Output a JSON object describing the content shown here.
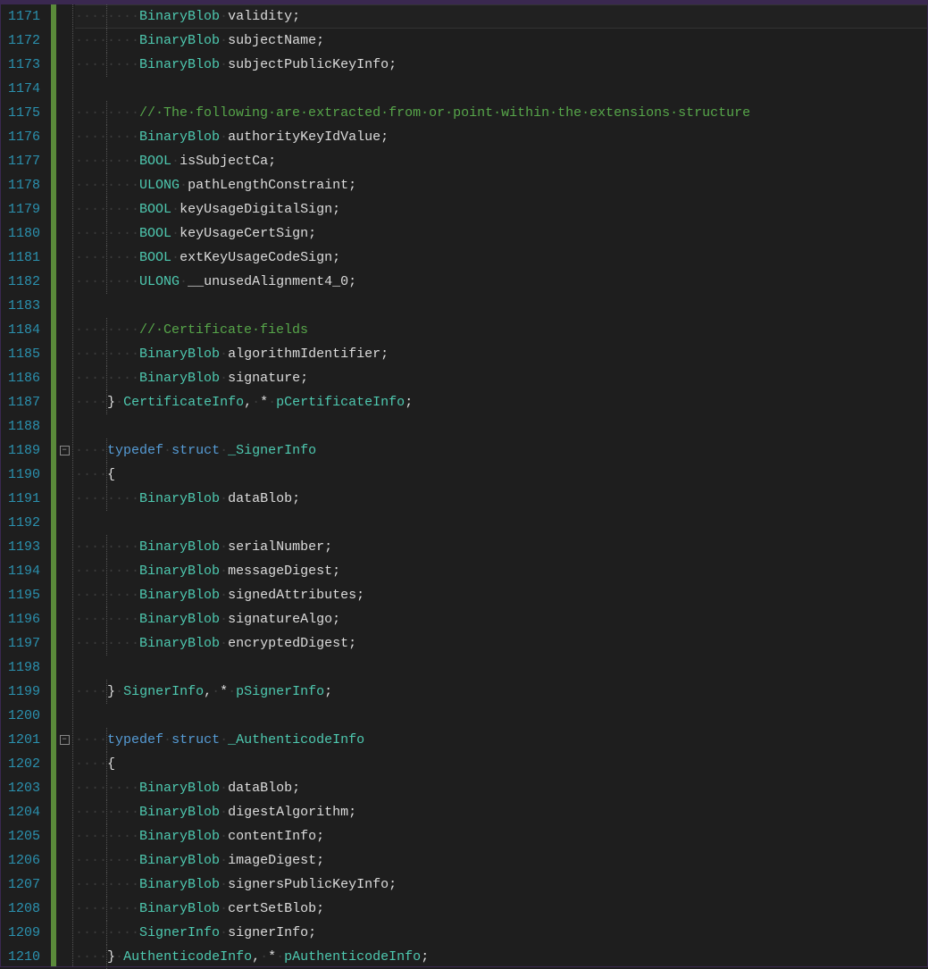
{
  "firstLine": 1171,
  "lines": [
    {
      "n": 1171,
      "indent": 2,
      "highlight": true,
      "tokens": [
        [
          "type",
          "BinaryBlob"
        ],
        [
          "ws",
          "·"
        ],
        [
          "ident",
          "validity"
        ],
        [
          "punct",
          ";"
        ]
      ]
    },
    {
      "n": 1172,
      "indent": 2,
      "tokens": [
        [
          "type",
          "BinaryBlob"
        ],
        [
          "ws",
          "·"
        ],
        [
          "ident",
          "subjectName"
        ],
        [
          "punct",
          ";"
        ]
      ]
    },
    {
      "n": 1173,
      "indent": 2,
      "tokens": [
        [
          "type",
          "BinaryBlob"
        ],
        [
          "ws",
          "·"
        ],
        [
          "ident",
          "subjectPublicKeyInfo"
        ],
        [
          "punct",
          ";"
        ]
      ]
    },
    {
      "n": 1174,
      "indent": 0,
      "tokens": []
    },
    {
      "n": 1175,
      "indent": 2,
      "tokens": [
        [
          "comment",
          "//·The·following·are·extracted·from·or·point·within·the·extensions·structure"
        ]
      ]
    },
    {
      "n": 1176,
      "indent": 2,
      "tokens": [
        [
          "type",
          "BinaryBlob"
        ],
        [
          "ws",
          "·"
        ],
        [
          "ident",
          "authorityKeyIdValue"
        ],
        [
          "punct",
          ";"
        ]
      ]
    },
    {
      "n": 1177,
      "indent": 2,
      "tokens": [
        [
          "type",
          "BOOL"
        ],
        [
          "ws",
          "·"
        ],
        [
          "ident",
          "isSubjectCa"
        ],
        [
          "punct",
          ";"
        ]
      ]
    },
    {
      "n": 1178,
      "indent": 2,
      "tokens": [
        [
          "type",
          "ULONG"
        ],
        [
          "ws",
          "·"
        ],
        [
          "ident",
          "pathLengthConstraint"
        ],
        [
          "punct",
          ";"
        ]
      ]
    },
    {
      "n": 1179,
      "indent": 2,
      "tokens": [
        [
          "type",
          "BOOL"
        ],
        [
          "ws",
          "·"
        ],
        [
          "ident",
          "keyUsageDigitalSign"
        ],
        [
          "punct",
          ";"
        ]
      ]
    },
    {
      "n": 1180,
      "indent": 2,
      "tokens": [
        [
          "type",
          "BOOL"
        ],
        [
          "ws",
          "·"
        ],
        [
          "ident",
          "keyUsageCertSign"
        ],
        [
          "punct",
          ";"
        ]
      ]
    },
    {
      "n": 1181,
      "indent": 2,
      "tokens": [
        [
          "type",
          "BOOL"
        ],
        [
          "ws",
          "·"
        ],
        [
          "ident",
          "extKeyUsageCodeSign"
        ],
        [
          "punct",
          ";"
        ]
      ]
    },
    {
      "n": 1182,
      "indent": 2,
      "tokens": [
        [
          "type",
          "ULONG"
        ],
        [
          "ws",
          "·"
        ],
        [
          "ident",
          "__unusedAlignment4_0"
        ],
        [
          "punct",
          ";"
        ]
      ]
    },
    {
      "n": 1183,
      "indent": 0,
      "tokens": []
    },
    {
      "n": 1184,
      "indent": 2,
      "tokens": [
        [
          "comment",
          "//·Certificate·fields"
        ]
      ]
    },
    {
      "n": 1185,
      "indent": 2,
      "tokens": [
        [
          "type",
          "BinaryBlob"
        ],
        [
          "ws",
          "·"
        ],
        [
          "ident",
          "algorithmIdentifier"
        ],
        [
          "punct",
          ";"
        ]
      ]
    },
    {
      "n": 1186,
      "indent": 2,
      "tokens": [
        [
          "type",
          "BinaryBlob"
        ],
        [
          "ws",
          "·"
        ],
        [
          "ident",
          "signature"
        ],
        [
          "punct",
          ";"
        ]
      ]
    },
    {
      "n": 1187,
      "indent": 1,
      "tokens": [
        [
          "punct",
          "}"
        ],
        [
          "ws",
          "·"
        ],
        [
          "type",
          "CertificateInfo"
        ],
        [
          "punct",
          ","
        ],
        [
          "ws",
          "·"
        ],
        [
          "punct",
          "*"
        ],
        [
          "ws",
          "·"
        ],
        [
          "type",
          "pCertificateInfo"
        ],
        [
          "punct",
          ";"
        ]
      ]
    },
    {
      "n": 1188,
      "indent": 0,
      "tokens": []
    },
    {
      "n": 1189,
      "indent": 1,
      "fold": true,
      "tokens": [
        [
          "kw",
          "typedef"
        ],
        [
          "ws",
          "·"
        ],
        [
          "kw",
          "struct"
        ],
        [
          "ws",
          "·"
        ],
        [
          "type",
          "_SignerInfo"
        ]
      ]
    },
    {
      "n": 1190,
      "indent": 1,
      "tokens": [
        [
          "punct",
          "{"
        ]
      ]
    },
    {
      "n": 1191,
      "indent": 2,
      "tokens": [
        [
          "type",
          "BinaryBlob"
        ],
        [
          "ws",
          "·"
        ],
        [
          "ident",
          "dataBlob"
        ],
        [
          "punct",
          ";"
        ]
      ]
    },
    {
      "n": 1192,
      "indent": 0,
      "tokens": []
    },
    {
      "n": 1193,
      "indent": 2,
      "tokens": [
        [
          "type",
          "BinaryBlob"
        ],
        [
          "ws",
          "·"
        ],
        [
          "ident",
          "serialNumber"
        ],
        [
          "punct",
          ";"
        ]
      ]
    },
    {
      "n": 1194,
      "indent": 2,
      "tokens": [
        [
          "type",
          "BinaryBlob"
        ],
        [
          "ws",
          "·"
        ],
        [
          "ident",
          "messageDigest"
        ],
        [
          "punct",
          ";"
        ]
      ]
    },
    {
      "n": 1195,
      "indent": 2,
      "tokens": [
        [
          "type",
          "BinaryBlob"
        ],
        [
          "ws",
          "·"
        ],
        [
          "ident",
          "signedAttributes"
        ],
        [
          "punct",
          ";"
        ]
      ]
    },
    {
      "n": 1196,
      "indent": 2,
      "tokens": [
        [
          "type",
          "BinaryBlob"
        ],
        [
          "ws",
          "·"
        ],
        [
          "ident",
          "signatureAlgo"
        ],
        [
          "punct",
          ";"
        ]
      ]
    },
    {
      "n": 1197,
      "indent": 2,
      "tokens": [
        [
          "type",
          "BinaryBlob"
        ],
        [
          "ws",
          "·"
        ],
        [
          "ident",
          "encryptedDigest"
        ],
        [
          "punct",
          ";"
        ]
      ]
    },
    {
      "n": 1198,
      "indent": 0,
      "tokens": []
    },
    {
      "n": 1199,
      "indent": 1,
      "tokens": [
        [
          "punct",
          "}"
        ],
        [
          "ws",
          "·"
        ],
        [
          "type",
          "SignerInfo"
        ],
        [
          "punct",
          ","
        ],
        [
          "ws",
          "·"
        ],
        [
          "punct",
          "*"
        ],
        [
          "ws",
          "·"
        ],
        [
          "type",
          "pSignerInfo"
        ],
        [
          "punct",
          ";"
        ]
      ]
    },
    {
      "n": 1200,
      "indent": 0,
      "tokens": []
    },
    {
      "n": 1201,
      "indent": 1,
      "fold": true,
      "tokens": [
        [
          "kw",
          "typedef"
        ],
        [
          "ws",
          "·"
        ],
        [
          "kw",
          "struct"
        ],
        [
          "ws",
          "·"
        ],
        [
          "type",
          "_AuthenticodeInfo"
        ]
      ]
    },
    {
      "n": 1202,
      "indent": 1,
      "tokens": [
        [
          "punct",
          "{"
        ]
      ]
    },
    {
      "n": 1203,
      "indent": 2,
      "tokens": [
        [
          "type",
          "BinaryBlob"
        ],
        [
          "ws",
          "·"
        ],
        [
          "ident",
          "dataBlob"
        ],
        [
          "punct",
          ";"
        ]
      ]
    },
    {
      "n": 1204,
      "indent": 2,
      "tokens": [
        [
          "type",
          "BinaryBlob"
        ],
        [
          "ws",
          "·"
        ],
        [
          "ident",
          "digestAlgorithm"
        ],
        [
          "punct",
          ";"
        ]
      ]
    },
    {
      "n": 1205,
      "indent": 2,
      "tokens": [
        [
          "type",
          "BinaryBlob"
        ],
        [
          "ws",
          "·"
        ],
        [
          "ident",
          "contentInfo"
        ],
        [
          "punct",
          ";"
        ]
      ]
    },
    {
      "n": 1206,
      "indent": 2,
      "tokens": [
        [
          "type",
          "BinaryBlob"
        ],
        [
          "ws",
          "·"
        ],
        [
          "ident",
          "imageDigest"
        ],
        [
          "punct",
          ";"
        ]
      ]
    },
    {
      "n": 1207,
      "indent": 2,
      "tokens": [
        [
          "type",
          "BinaryBlob"
        ],
        [
          "ws",
          "·"
        ],
        [
          "ident",
          "signersPublicKeyInfo"
        ],
        [
          "punct",
          ";"
        ]
      ]
    },
    {
      "n": 1208,
      "indent": 2,
      "tokens": [
        [
          "type",
          "BinaryBlob"
        ],
        [
          "ws",
          "·"
        ],
        [
          "ident",
          "certSetBlob"
        ],
        [
          "punct",
          ";"
        ]
      ]
    },
    {
      "n": 1209,
      "indent": 2,
      "tokens": [
        [
          "type",
          "SignerInfo"
        ],
        [
          "ws",
          "·"
        ],
        [
          "ident",
          "signerInfo"
        ],
        [
          "punct",
          ";"
        ]
      ]
    },
    {
      "n": 1210,
      "indent": 1,
      "tokens": [
        [
          "punct",
          "}"
        ],
        [
          "ws",
          "·"
        ],
        [
          "type",
          "AuthenticodeInfo"
        ],
        [
          "punct",
          ","
        ],
        [
          "ws",
          "·"
        ],
        [
          "punct",
          "*"
        ],
        [
          "ws",
          "·"
        ],
        [
          "type",
          "pAuthenticodeInfo"
        ],
        [
          "punct",
          ";"
        ]
      ]
    }
  ],
  "foldMinus": "−"
}
